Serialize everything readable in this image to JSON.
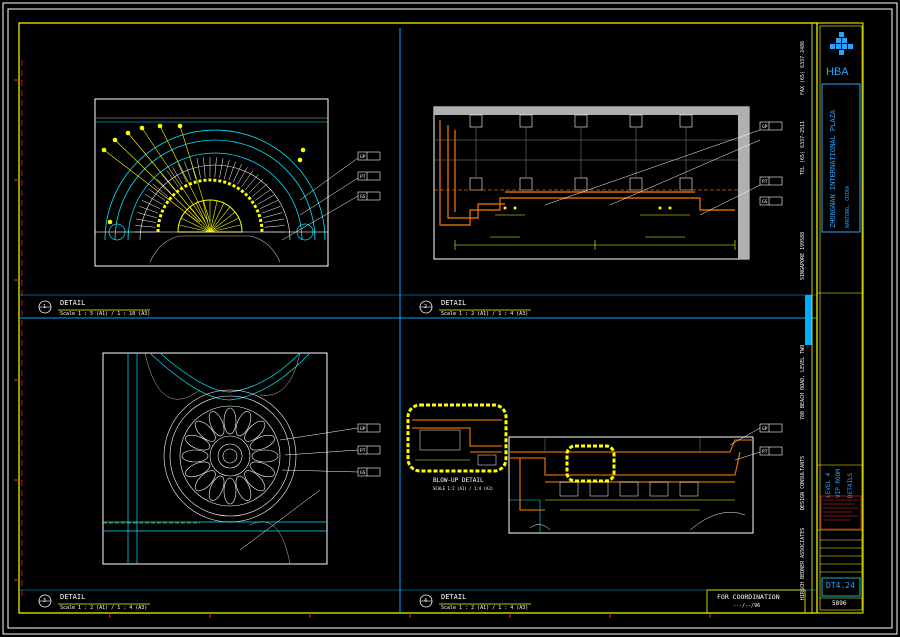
{
  "colors": {
    "background": "#000000",
    "frame": "#ffffff",
    "border": "#ffff00",
    "grid": "#00aaff",
    "detail_line": "#00e5ff",
    "dimension": "#ffff00",
    "wall": "#d36a00",
    "section_gray": "#b0b0b0",
    "red_text": "#ff2a2a",
    "logo": "#2aa3ff"
  },
  "titleblock": {
    "brand": "HBA",
    "project": "ZHONGNAN INTERNATIONAL PLAZA",
    "location": "NANTONG, CHINA",
    "side_consultant": "HIRSCH BEDNER ASSOCIATES",
    "side_design": "DESIGN CONSULTANTS",
    "side_address": "780 BEACH ROAD, LEVEL TWO",
    "side_city": "SINGAPORE 199588",
    "side_tel": "TEL (65) 6337-2511",
    "side_fax": "FAX (65) 6337-2486",
    "title_level": "LEVEL 4",
    "title_room": "VIP ROOM",
    "title_type": "DETAILS",
    "drawing_no": "DT4.24",
    "sheet_code": "5896"
  },
  "details": [
    {
      "num": "1",
      "label": "DETAIL",
      "scale": "Scale 1 : 5 (A1) / 1 : 10 (A3)"
    },
    {
      "num": "2",
      "label": "DETAIL",
      "scale": "Scale 1 : 2 (A1) / 1 : 4 (A3)"
    },
    {
      "num": "3",
      "label": "DETAIL",
      "scale": "Scale 1 : 2 (A1) / 1 : 4 (A3)"
    },
    {
      "num": "4",
      "label": "DETAIL",
      "scale": "Scale 1 : 2 (A1) / 1 : 4 (A3)"
    }
  ],
  "blowup": {
    "label": "BLOW-UP DETAIL",
    "scale": "SCALE 1:2 (A1) / 1:4 (A3)"
  },
  "coordination": {
    "label": "FOR COORDINATION",
    "code": "---/--/96"
  },
  "callouts": [
    {
      "tag": "GP"
    },
    {
      "tag": "PT"
    },
    {
      "tag": "GS"
    }
  ]
}
